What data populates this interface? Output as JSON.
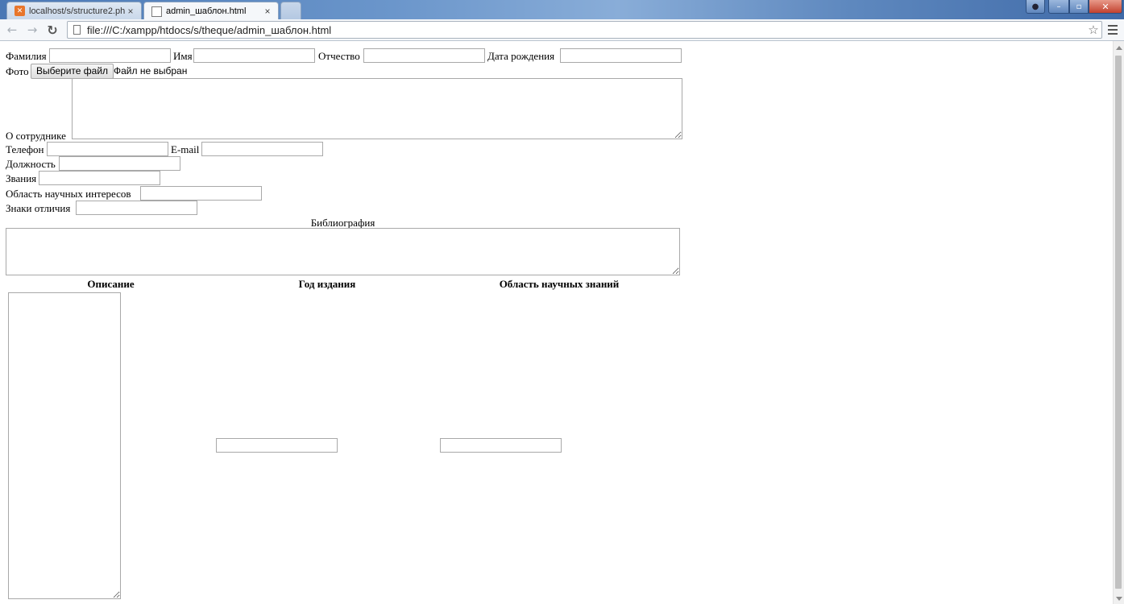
{
  "browser": {
    "tabs": [
      {
        "title": "localhost/s/structure2.php",
        "close": "×"
      },
      {
        "title": "admin_шаблон.html",
        "close": "×"
      }
    ],
    "url": "file:///C:/xampp/htdocs/s/theque/admin_шаблон.html",
    "window_controls": {
      "minimize": "–",
      "maximize": "▫",
      "close": "✕",
      "user": "●"
    }
  },
  "form": {
    "surname_label": "Фамилия",
    "name_label": "Имя",
    "patronymic_label": "Отчество",
    "birthdate_label": "Дата рождения",
    "photo_label": "Фото",
    "file_button": "Выберите файл",
    "file_status": "Файл не выбран",
    "about_label": "О сотруднике",
    "phone_label": "Телефон",
    "email_label": "E-mail",
    "position_label": "Должность",
    "titles_label": "Звания",
    "interests_label": "Область научных интересов",
    "awards_label": "Знаки отличия",
    "bibliography_label": "Библиография",
    "table_headers": {
      "description": "Описание",
      "year": "Год издания",
      "field": "Область научных знаний"
    }
  }
}
